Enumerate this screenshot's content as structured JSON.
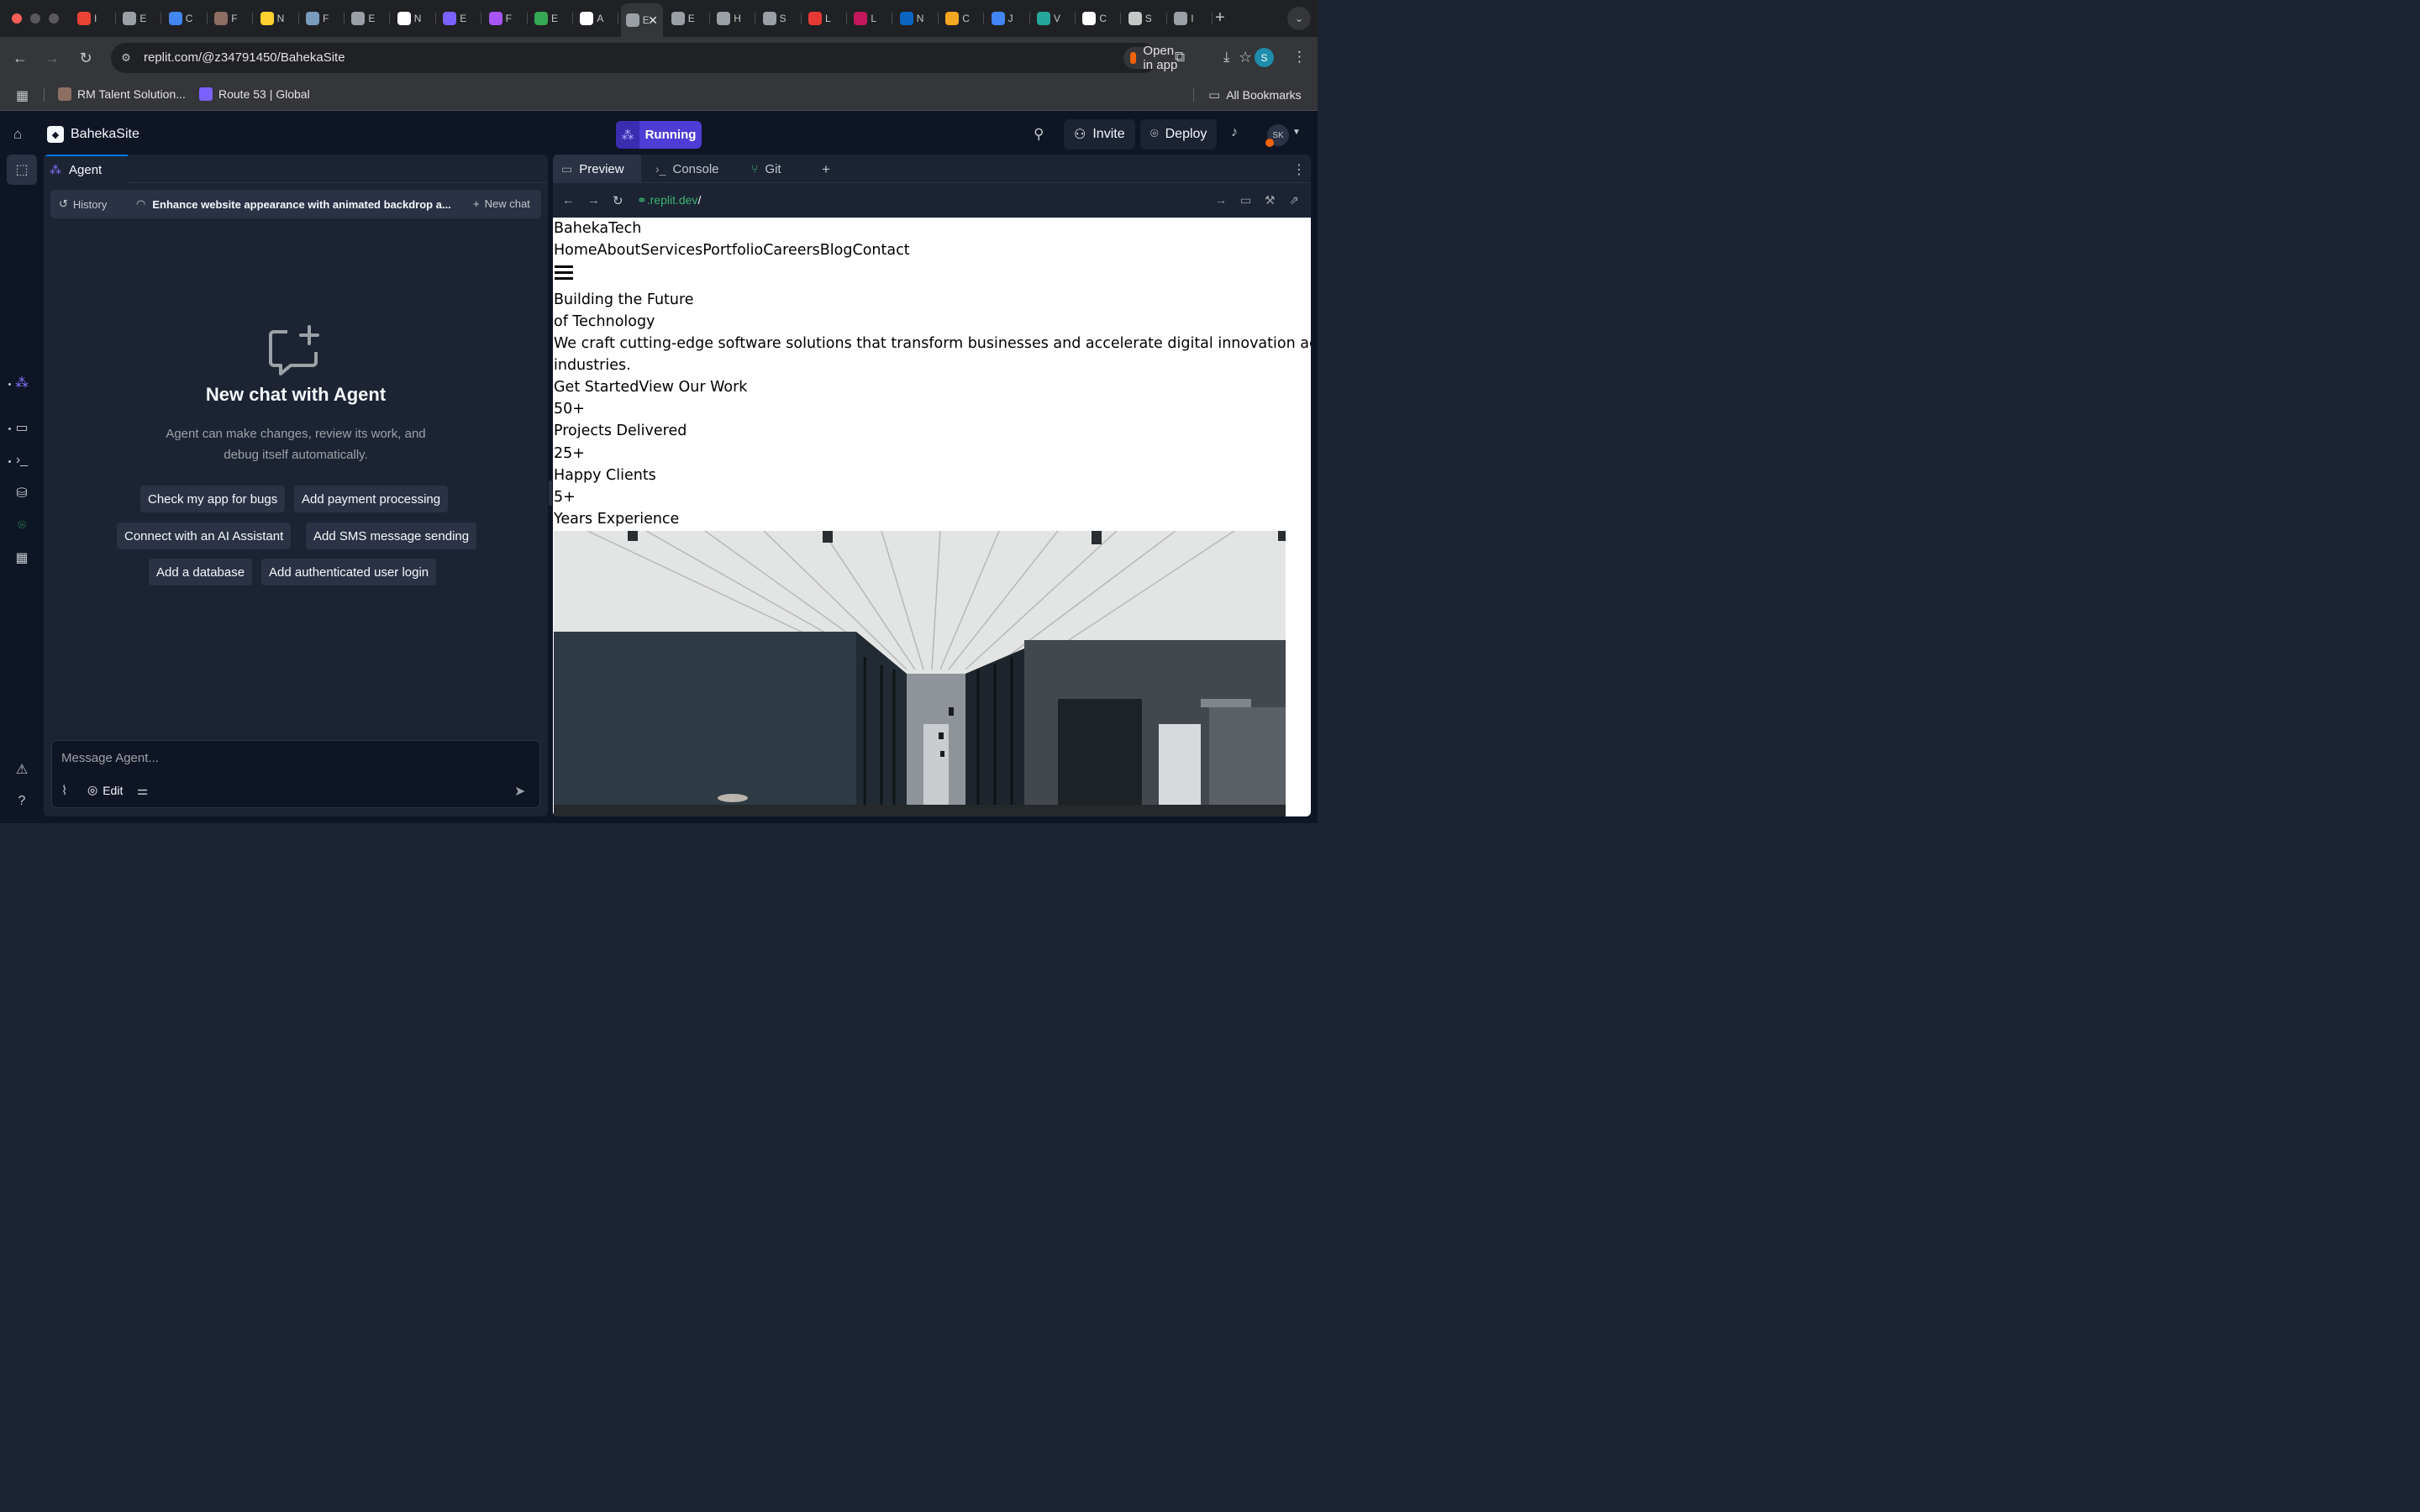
{
  "browser": {
    "tabs": [
      {
        "letter": "I",
        "icon": "gmail-icon",
        "color": "#ea4335"
      },
      {
        "letter": "E",
        "icon": "globe-icon",
        "color": "#9aa0a6"
      },
      {
        "letter": "C",
        "icon": "calendar-icon",
        "color": "#4285f4"
      },
      {
        "letter": "F",
        "icon": "app-icon",
        "color": "#8d6e63"
      },
      {
        "letter": "N",
        "icon": "miro-icon",
        "color": "#ffd02f"
      },
      {
        "letter": "F",
        "icon": "postgres-icon",
        "color": "#7a9cbf"
      },
      {
        "letter": "E",
        "icon": "globe-icon",
        "color": "#9aa0a6"
      },
      {
        "letter": "N",
        "icon": "notion-icon",
        "color": "#ffffff"
      },
      {
        "letter": "E",
        "icon": "shield-icon",
        "color": "#7b61ff"
      },
      {
        "letter": "F",
        "icon": "cube-icon",
        "color": "#a855f7"
      },
      {
        "letter": "E",
        "icon": "sheet-icon",
        "color": "#34a853"
      },
      {
        "letter": "A",
        "icon": "openai-icon",
        "color": "#ffffff"
      },
      {
        "letter": "E",
        "icon": "replit-tab-icon",
        "color": "#9aa0a6",
        "active": true
      },
      {
        "letter": "E",
        "icon": "globe-icon",
        "color": "#9aa0a6"
      },
      {
        "letter": "H",
        "icon": "globe-icon",
        "color": "#9aa0a6"
      },
      {
        "letter": "S",
        "icon": "globe-icon",
        "color": "#9aa0a6"
      },
      {
        "letter": "L",
        "icon": "pdf-icon",
        "color": "#e53935"
      },
      {
        "letter": "L",
        "icon": "eye-icon",
        "color": "#c2185b"
      },
      {
        "letter": "N",
        "icon": "linkedin-icon",
        "color": "#0a66c2"
      },
      {
        "letter": "C",
        "icon": "weather-icon",
        "color": "#f5a623"
      },
      {
        "letter": "J",
        "icon": "grid-icon",
        "color": "#4285f4"
      },
      {
        "letter": "V",
        "icon": "leaf-icon",
        "color": "#26a69a"
      },
      {
        "letter": "C",
        "icon": "google-icon",
        "color": "#ffffff"
      },
      {
        "letter": "S",
        "icon": "settings-icon",
        "color": "#c4c7c5"
      },
      {
        "letter": "I",
        "icon": "globe-icon",
        "color": "#9aa0a6"
      }
    ],
    "url": "replit.com/@z34791450/BahekaSite",
    "open_in_app": "Open in app",
    "profile_initial": "S",
    "bookmarks": [
      {
        "label": "RM Talent Solution...",
        "color": "#8d6e63"
      },
      {
        "label": "Route 53 | Global",
        "color": "#7b61ff"
      }
    ],
    "all_bookmarks": "All Bookmarks"
  },
  "app": {
    "repl_name": "BahekaSite",
    "run_status": "Running",
    "invite": "Invite",
    "deploy": "Deploy",
    "user_initials": "SK"
  },
  "agent": {
    "tab_label": "Agent",
    "history": "History",
    "chat_title": "Enhance website appearance with animated backdrop a...",
    "new_chat": "New chat",
    "empty_title": "New chat with Agent",
    "empty_desc": "Agent can make changes, review its work, and debug itself automatically.",
    "suggestions": [
      "Check my app for bugs",
      "Add payment processing",
      "Connect with an AI Assistant",
      "Add SMS message sending",
      "Add a database",
      "Add authenticated user login"
    ],
    "composer_placeholder": "Message Agent...",
    "edit_label": "Edit"
  },
  "preview": {
    "tabs": [
      "Preview",
      "Console",
      "Git"
    ],
    "url_domain": ".replit.dev",
    "url_path": "/",
    "site": {
      "brand": "BahekaTech",
      "nav": "HomeAboutServicesPortfolioCareersBlogContact",
      "hero_line1": "Building the Future",
      "hero_line2": "of Technology",
      "hero_desc1": "We craft cutting-edge software solutions that transform businesses and accelerate digital innovation across",
      "hero_desc2": "industries.",
      "cta": "Get StartedView Our Work",
      "stats": [
        {
          "value": "50+",
          "label": "Projects Delivered"
        },
        {
          "value": "25+",
          "label": "Happy Clients"
        },
        {
          "value": "5+",
          "label": "Years Experience"
        }
      ]
    }
  }
}
